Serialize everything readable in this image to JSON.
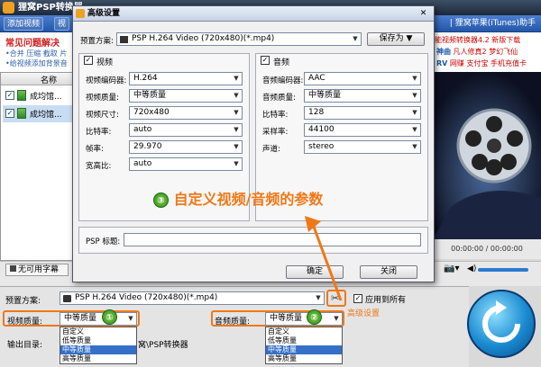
{
  "app": {
    "title": "狸窝PSP转换器",
    "tab_add": "添加视频",
    "tab2": "视",
    "right_title": "狸窝苹果(iTunes)助手",
    "right_sep": "|"
  },
  "faq": {
    "title": "常见问题解决",
    "line1": "•合并 压缩 截取 片",
    "line2": "•给视频添加背景音"
  },
  "ads": {
    "line1": "能视频转换器4.2 新版下载",
    "line2a": "神曲",
    "line2b": "凡人修真2",
    "line2c": "梦幻飞仙",
    "line3a": "RV",
    "line3b": "网赚",
    "line3c": "支付宝",
    "line3d": "手机充值卡"
  },
  "list": {
    "header": "名称",
    "rows": [
      {
        "label": "成均馆..."
      },
      {
        "label": "成均馆..."
      }
    ]
  },
  "preview": {
    "time": "00:00:00 / 00:00:00"
  },
  "subtitle": {
    "label": "无可用字幕"
  },
  "dialog": {
    "title": "高级设置",
    "preset_label": "预置方案:",
    "preset_value": "PSP H.264 Video (720x480)(*.mp4)",
    "save_as": "保存为",
    "video_group": "视频",
    "audio_group": "音频",
    "video_fields": [
      {
        "label": "视频编码器:",
        "value": "H.264"
      },
      {
        "label": "视频质量:",
        "value": "中等质量"
      },
      {
        "label": "视频尺寸:",
        "value": "720x480"
      },
      {
        "label": "比特率:",
        "value": "auto"
      },
      {
        "label": "帧率:",
        "value": "29.970"
      },
      {
        "label": "宽高比:",
        "value": "auto"
      }
    ],
    "audio_fields": [
      {
        "label": "音频编码器:",
        "value": "AAC"
      },
      {
        "label": "音频质量:",
        "value": "中等质量"
      },
      {
        "label": "比特率:",
        "value": "128"
      },
      {
        "label": "采样率:",
        "value": "44100"
      },
      {
        "label": "声道:",
        "value": "stereo"
      }
    ],
    "psp_title_label": "PSP 标题:",
    "ok": "确定",
    "cancel": "关闭"
  },
  "annotation": {
    "badge3": "③",
    "text": "自定义视频/音频的参数",
    "badge1": "①",
    "badge2": "②",
    "advanced": "高级设置"
  },
  "bottom": {
    "preset_label": "预置方案:",
    "preset_value": "PSP H.264 Video (720x480)(*.mp4)",
    "apply_all": "应用到所有",
    "video_quality_label": "视频质量:",
    "video_quality_value": "中等质量",
    "audio_quality_label": "音频质量:",
    "audio_quality_value": "中等质量",
    "output_label": "输出目录:",
    "output_value": "窝\\PSP转换器",
    "options": [
      "自定义",
      "低等质量",
      "中等质量",
      "高等质量"
    ]
  },
  "colors": {
    "accent": "#f07818",
    "toolbar": "#2457a8",
    "selected": "#3470c8"
  }
}
